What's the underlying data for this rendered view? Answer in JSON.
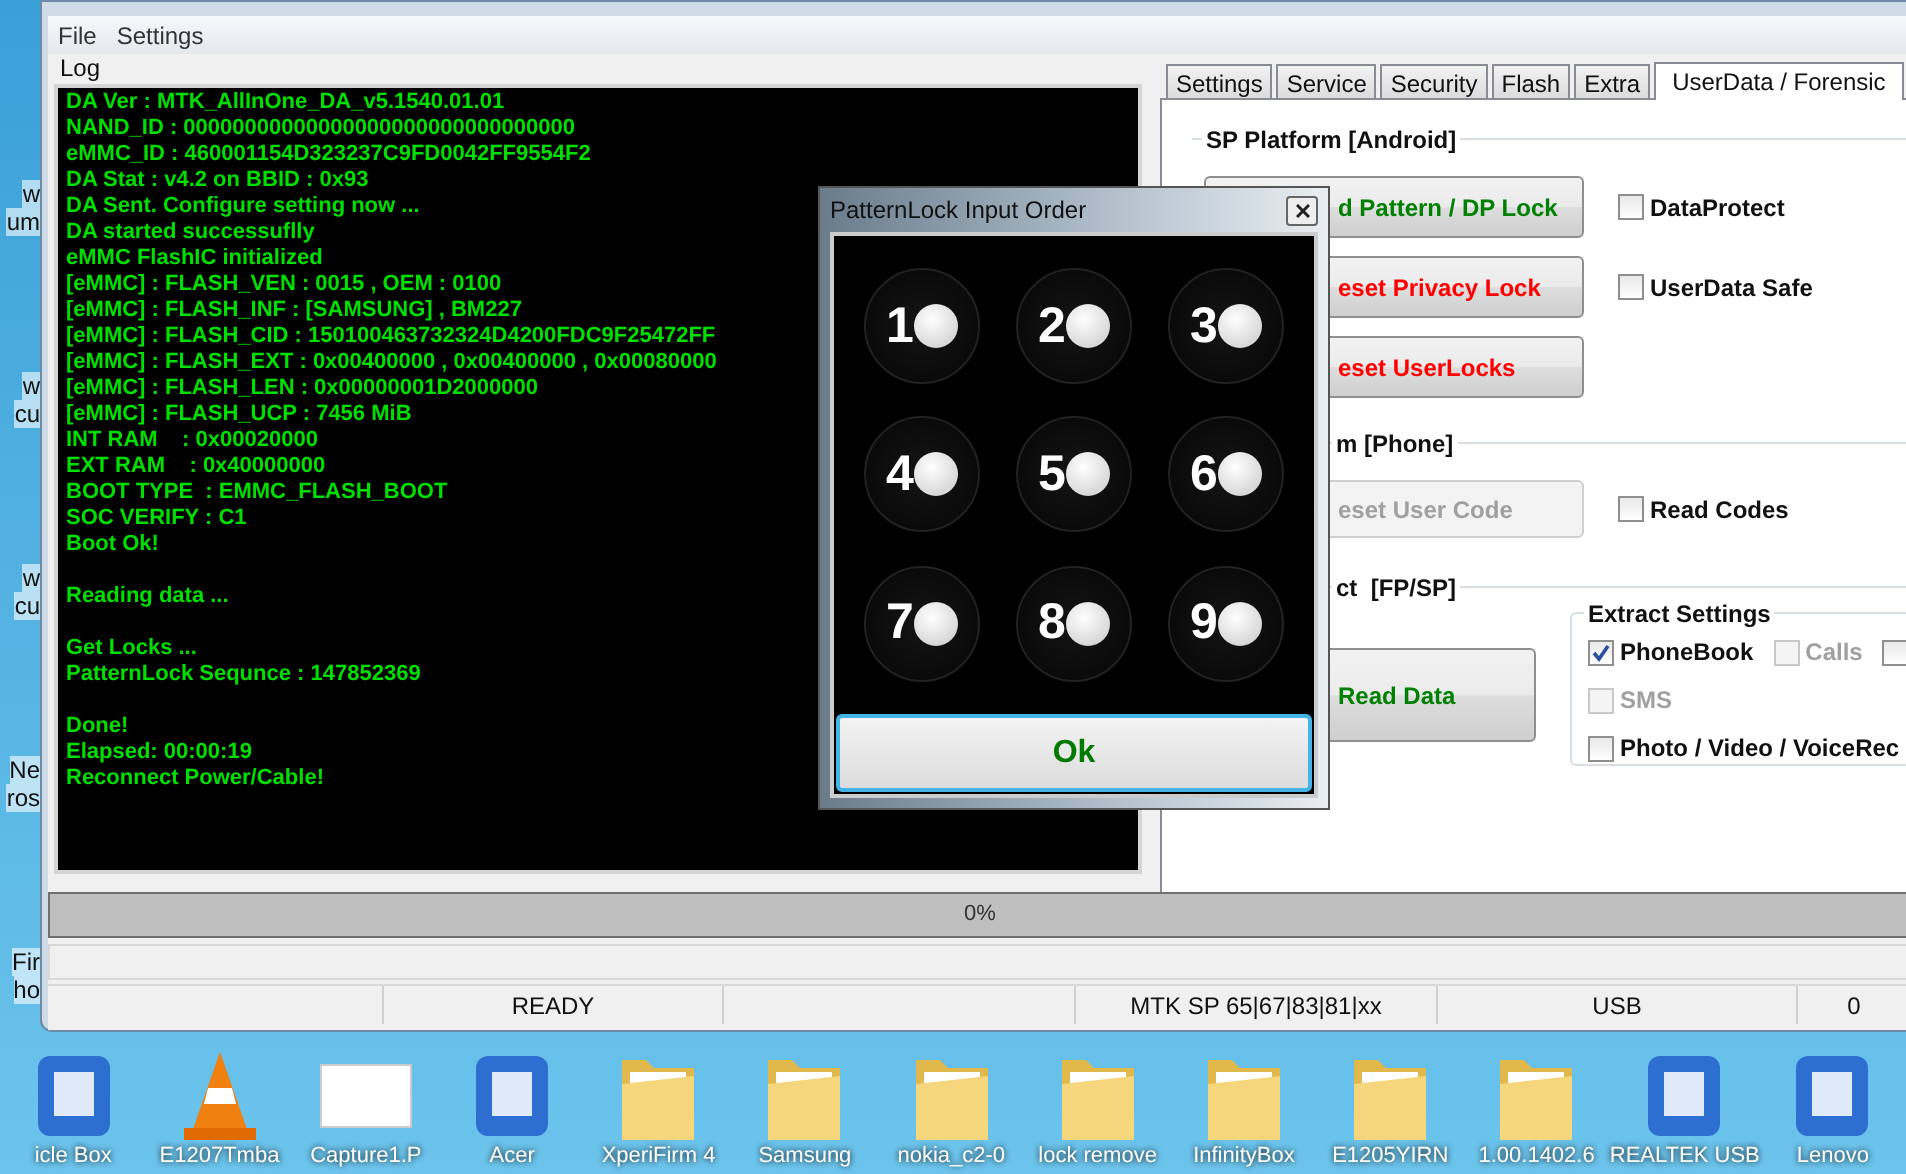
{
  "menu": [
    "File",
    "Settings"
  ],
  "log": {
    "title": "Log",
    "blocks": [
      [
        "DA Ver : MTK_AllInOne_DA_v5.1540.01.01",
        "NAND_ID : 00000000000000000000000000000000",
        "eMMC_ID : 460001154D323237C9FD0042FF9554F2",
        "DA Stat : v4.2 on BBID : 0x93",
        "DA Sent. Configure setting now ...",
        "DA started successuflly",
        "eMMC FlashIC initialized",
        "[eMMC] : FLASH_VEN : 0015 , OEM : 0100",
        "[eMMC] : FLASH_INF : [SAMSUNG] , BM227",
        "[eMMC] : FLASH_CID : 150100463732324D4200FDC9F25472FF",
        "[eMMC] : FLASH_EXT : 0x00400000 , 0x00400000 , 0x00080000",
        "[eMMC] : FLASH_LEN : 0x00000001D2000000",
        "[eMMC] : FLASH_UCP : 7456 MiB",
        "INT RAM    : 0x00020000",
        "EXT RAM    : 0x40000000",
        "BOOT TYPE  : EMMC_FLASH_BOOT",
        "SOC VERIFY : C1",
        "Boot Ok!"
      ],
      [
        "Reading data ..."
      ],
      [
        "Get Locks ...",
        "PatternLock Sequnce : 147852369"
      ],
      [
        "Done!",
        "Elapsed: 00:00:19",
        "Reconnect Power/Cable!"
      ]
    ]
  },
  "tabs": [
    {
      "label": "Settings",
      "selected": false
    },
    {
      "label": "Service",
      "selected": false
    },
    {
      "label": "Security",
      "selected": false
    },
    {
      "label": "Flash",
      "selected": false
    },
    {
      "label": "Extra",
      "selected": false
    },
    {
      "label": "UserData / Forensic",
      "selected": true
    }
  ],
  "sp_platform": {
    "title": "SP Platform [Android]",
    "rows": [
      {
        "button": {
          "label": "d Pattern / DP Lock",
          "color": "#008000",
          "disabled": false
        },
        "checkbox": {
          "label": "DataProtect",
          "checked": false
        }
      },
      {
        "button": {
          "label": "eset Privacy Lock",
          "color": "#ff0000",
          "disabled": false
        },
        "checkbox": {
          "label": "UserData Safe",
          "checked": false
        }
      },
      {
        "button": {
          "label": "eset UserLocks",
          "color": "#ff0000",
          "disabled": false
        }
      }
    ]
  },
  "phone": {
    "title": "m [Phone]",
    "rows": [
      {
        "button": {
          "label": "eset User Code",
          "color": "#a0a0a0",
          "disabled": true
        },
        "checkbox": {
          "label": "Read Codes",
          "checked": false
        }
      }
    ]
  },
  "extract": {
    "title": "ct  [FP/SP]",
    "button": {
      "label": "Read Data",
      "color": "#008000"
    },
    "settings": {
      "title": "Extract Settings",
      "rows": [
        [
          {
            "label": "PhoneBook",
            "checked": true,
            "disabled": false
          },
          {
            "label": "Calls",
            "checked": false,
            "disabled": true
          },
          {
            "checked": false,
            "disabled": false
          }
        ],
        [
          {
            "label": "SMS",
            "checked": false,
            "disabled": true
          }
        ],
        [
          {
            "label": "Photo / Video / VoiceRec",
            "checked": false,
            "disabled": false
          }
        ]
      ]
    }
  },
  "dialog": {
    "title": "PatternLock Input Order",
    "dots": [
      "1",
      "2",
      "3",
      "4",
      "5",
      "6",
      "7",
      "8",
      "9"
    ],
    "ok": "Ok"
  },
  "progress": {
    "text": "0%",
    "level": 0
  },
  "status_bar": [
    "READY",
    "MTK SP 65|67|83|81|xx",
    "USB",
    "0"
  ],
  "left_edge_labels": [
    [
      "w",
      "um"
    ],
    [
      "w",
      "cu"
    ],
    [
      "w",
      "cu"
    ],
    [
      "Ne",
      "ros"
    ],
    [
      "Fir",
      "ho"
    ]
  ],
  "desktop_icons": [
    {
      "label": "icle Box",
      "kind": "app"
    },
    {
      "label": "E1207Tmba",
      "kind": "cone"
    },
    {
      "label": "Capture1.P",
      "kind": "image"
    },
    {
      "label": "Acer",
      "kind": "app"
    },
    {
      "label": "XperiFirm 4",
      "kind": "folder"
    },
    {
      "label": "Samsung",
      "kind": "folder"
    },
    {
      "label": "nokia_c2-0",
      "kind": "folder"
    },
    {
      "label": "lock remove",
      "kind": "folder"
    },
    {
      "label": "InfinityBox",
      "kind": "folder"
    },
    {
      "label": "E1205YIRN",
      "kind": "folder"
    },
    {
      "label": "1.00.1402.6",
      "kind": "folder"
    },
    {
      "label": "REALTEK USB",
      "kind": "app"
    },
    {
      "label": "Lenovo",
      "kind": "app"
    }
  ]
}
